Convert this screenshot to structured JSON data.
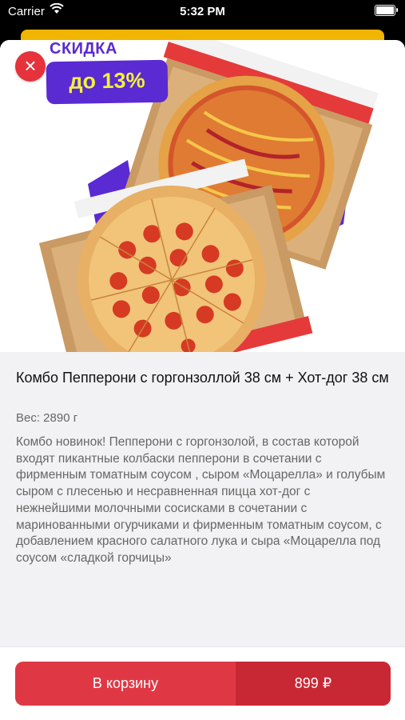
{
  "status_bar": {
    "carrier": "Carrier",
    "time": "5:32 PM"
  },
  "promo": {
    "label": "СКИДКА",
    "value": "до 13%"
  },
  "product": {
    "title": "Комбо Пепперони с горгонзоллой 38 см + Хот-дог 38 см",
    "weight": "Вес: 2890 г",
    "description": "Комбо новинок! Пепперони с горгонзолой, в состав которой входят пикантные колбаски пепперони в сочетании с фирменным томатным соусом , сыром «Моцарелла» и голубым сыром с плесенью и несравненная пицца хот-дог с  нежнейшими молочными сосисками в сочетании с маринованными огурчиками и фирменным томатным соусом, с добавлением красного салатного лука и сыра «Моцарелла под соусом «сладкой горчицы»"
  },
  "cart": {
    "button_label": "В корзину",
    "price": "899 ₽"
  },
  "icons": {
    "close": "close-icon",
    "wifi": "wifi-icon",
    "battery": "battery-icon"
  },
  "colors": {
    "accent": "#df3844",
    "promo_purple": "#5a2ad2",
    "promo_yellow": "#f2f03c"
  }
}
